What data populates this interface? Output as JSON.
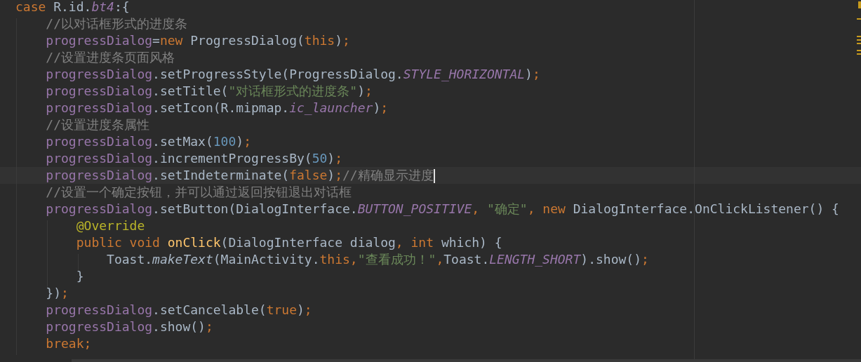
{
  "editor": {
    "lines": [
      {
        "current": false,
        "tokens": [
          {
            "text": "case",
            "kind": "keyword"
          },
          {
            "text": " R.id.",
            "kind": "plain"
          },
          {
            "text": "bt4",
            "kind": "constant"
          },
          {
            "text": ":{",
            "kind": "plain"
          }
        ]
      },
      {
        "current": false,
        "tokens": [
          {
            "text": "    //以对话框形式的进度条",
            "kind": "comment"
          }
        ]
      },
      {
        "current": false,
        "tokens": [
          {
            "text": "    progressDialog",
            "kind": "field"
          },
          {
            "text": "=",
            "kind": "plain"
          },
          {
            "text": "new",
            "kind": "keyword"
          },
          {
            "text": " ProgressDialog(",
            "kind": "plain"
          },
          {
            "text": "this",
            "kind": "keyword"
          },
          {
            "text": ")",
            "kind": "plain"
          },
          {
            "text": ";",
            "kind": "keyword"
          }
        ]
      },
      {
        "current": false,
        "tokens": [
          {
            "text": "    //设置进度条页面风格",
            "kind": "comment"
          }
        ]
      },
      {
        "current": false,
        "tokens": [
          {
            "text": "    progressDialog",
            "kind": "field"
          },
          {
            "text": ".setProgressStyle(ProgressDialog.",
            "kind": "plain"
          },
          {
            "text": "STYLE_HORIZONTAL",
            "kind": "constant"
          },
          {
            "text": ")",
            "kind": "plain"
          },
          {
            "text": ";",
            "kind": "keyword"
          }
        ]
      },
      {
        "current": false,
        "tokens": [
          {
            "text": "    progressDialog",
            "kind": "field"
          },
          {
            "text": ".setTitle(",
            "kind": "plain"
          },
          {
            "text": "\"对话框形式的进度条\"",
            "kind": "string"
          },
          {
            "text": ")",
            "kind": "plain"
          },
          {
            "text": ";",
            "kind": "keyword"
          }
        ]
      },
      {
        "current": false,
        "tokens": [
          {
            "text": "    progressDialog",
            "kind": "field"
          },
          {
            "text": ".setIcon(R.mipmap.",
            "kind": "plain"
          },
          {
            "text": "ic_launcher",
            "kind": "constant"
          },
          {
            "text": ")",
            "kind": "plain"
          },
          {
            "text": ";",
            "kind": "keyword"
          }
        ]
      },
      {
        "current": false,
        "tokens": [
          {
            "text": "    //设置进度条属性",
            "kind": "comment"
          }
        ]
      },
      {
        "current": false,
        "tokens": [
          {
            "text": "    progressDialog",
            "kind": "field"
          },
          {
            "text": ".setMax(",
            "kind": "plain"
          },
          {
            "text": "100",
            "kind": "number"
          },
          {
            "text": ")",
            "kind": "plain"
          },
          {
            "text": ";",
            "kind": "keyword"
          }
        ]
      },
      {
        "current": false,
        "tokens": [
          {
            "text": "    progressDialog",
            "kind": "field"
          },
          {
            "text": ".incrementProgressBy(",
            "kind": "plain"
          },
          {
            "text": "50",
            "kind": "number"
          },
          {
            "text": ")",
            "kind": "plain"
          },
          {
            "text": ";",
            "kind": "keyword"
          }
        ]
      },
      {
        "current": true,
        "tokens": [
          {
            "text": "    progressDialog",
            "kind": "field"
          },
          {
            "text": ".setIndeterminate(",
            "kind": "plain"
          },
          {
            "text": "false",
            "kind": "keyword"
          },
          {
            "text": ")",
            "kind": "plain"
          },
          {
            "text": ";",
            "kind": "keyword"
          },
          {
            "text": "//精确显示进度",
            "kind": "comment"
          }
        ]
      },
      {
        "current": false,
        "tokens": [
          {
            "text": "    //设置一个确定按钮，并可以通过返回按钮退出对话框",
            "kind": "comment"
          }
        ]
      },
      {
        "current": false,
        "tokens": [
          {
            "text": "    progressDialog",
            "kind": "field"
          },
          {
            "text": ".setButton(DialogInterface.",
            "kind": "plain"
          },
          {
            "text": "BUTTON_POSITIVE",
            "kind": "constant"
          },
          {
            "text": ", ",
            "kind": "keyword"
          },
          {
            "text": "\"确定\"",
            "kind": "string"
          },
          {
            "text": ", new",
            "kind": "keyword"
          },
          {
            "text": " DialogInterface.OnClickListener() {",
            "kind": "plain"
          }
        ]
      },
      {
        "current": false,
        "tokens": [
          {
            "text": "        @Override",
            "kind": "annotation"
          }
        ]
      },
      {
        "current": false,
        "tokens": [
          {
            "text": "        public void ",
            "kind": "keyword"
          },
          {
            "text": "onClick",
            "kind": "method"
          },
          {
            "text": "(DialogInterface dialog",
            "kind": "plain"
          },
          {
            "text": ", int",
            "kind": "keyword"
          },
          {
            "text": " which) {",
            "kind": "plain"
          }
        ]
      },
      {
        "current": false,
        "tokens": [
          {
            "text": "            Toast.",
            "kind": "plain"
          },
          {
            "text": "makeText",
            "kind": "italic"
          },
          {
            "text": "(MainActivity.",
            "kind": "plain"
          },
          {
            "text": "this,",
            "kind": "keyword"
          },
          {
            "text": "\"查看成功！\"",
            "kind": "string"
          },
          {
            "text": ",",
            "kind": "keyword"
          },
          {
            "text": "Toast.",
            "kind": "plain"
          },
          {
            "text": "LENGTH_SHORT",
            "kind": "constant"
          },
          {
            "text": ").show()",
            "kind": "plain"
          },
          {
            "text": ";",
            "kind": "keyword"
          }
        ]
      },
      {
        "current": false,
        "tokens": [
          {
            "text": "        }",
            "kind": "plain"
          }
        ]
      },
      {
        "current": false,
        "tokens": [
          {
            "text": "    })",
            "kind": "plain"
          },
          {
            "text": ";",
            "kind": "keyword"
          }
        ]
      },
      {
        "current": false,
        "tokens": [
          {
            "text": "    progressDialog",
            "kind": "field"
          },
          {
            "text": ".setCancelable(",
            "kind": "plain"
          },
          {
            "text": "true",
            "kind": "keyword"
          },
          {
            "text": ")",
            "kind": "plain"
          },
          {
            "text": ";",
            "kind": "keyword"
          }
        ]
      },
      {
        "current": false,
        "tokens": [
          {
            "text": "    progressDialog",
            "kind": "field"
          },
          {
            "text": ".show()",
            "kind": "plain"
          },
          {
            "text": ";",
            "kind": "keyword"
          }
        ]
      },
      {
        "current": false,
        "tokens": [
          {
            "text": "    break;",
            "kind": "keyword"
          }
        ]
      }
    ]
  }
}
